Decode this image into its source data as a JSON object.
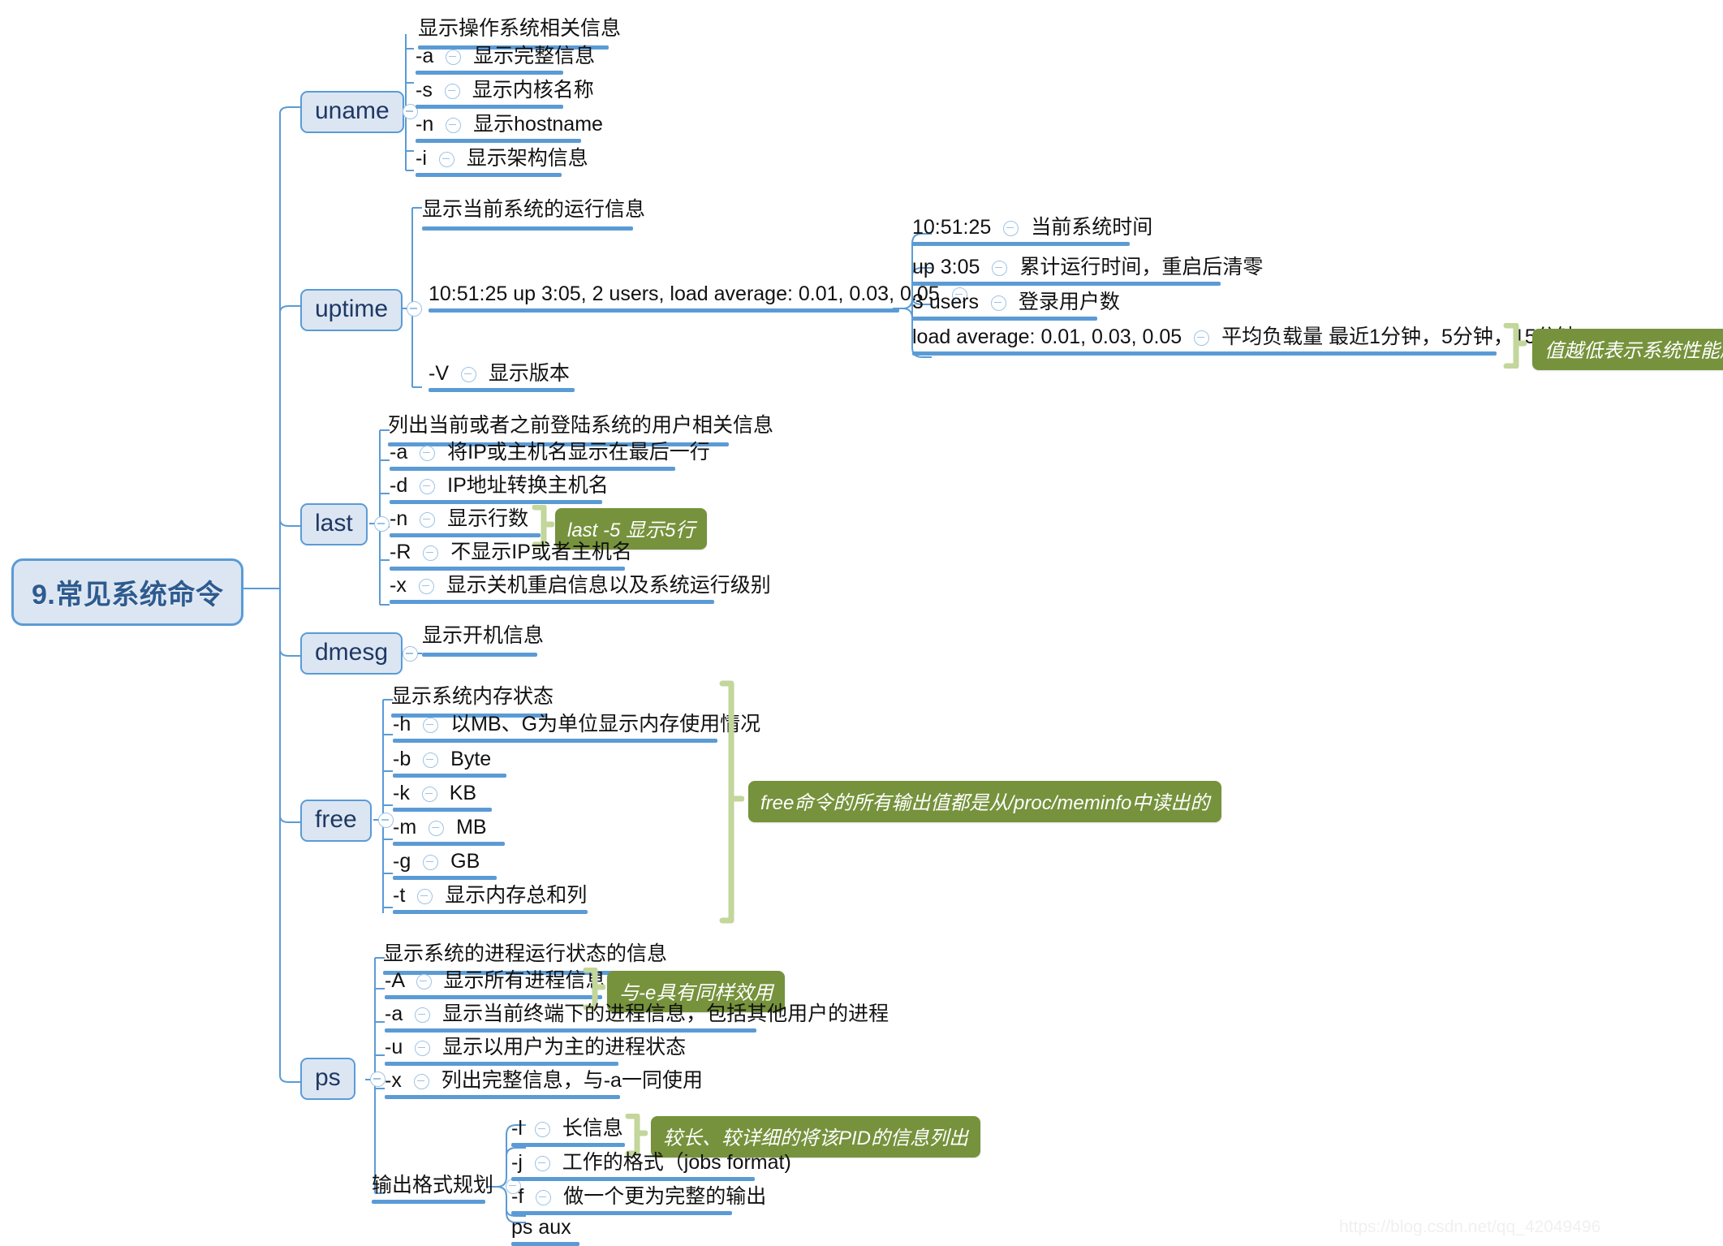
{
  "root": {
    "label": "9.常见系统命令"
  },
  "watermark": {
    "text": "https://blog.csdn.net/qq_42049496"
  },
  "colors": {
    "node_fill": "#dce6f2",
    "node_border": "#5b9bd5",
    "underline": "#5b9bd5",
    "callout_bg": "#76923c",
    "callout_text": "#ffffff",
    "brace": "#c3d69b",
    "root_text": "#2e5b8f"
  },
  "branches": [
    {
      "name": "uname",
      "label": "uname",
      "topic": "显示操作系统相关信息",
      "children": [
        {
          "flag": "-a",
          "desc": "显示完整信息"
        },
        {
          "flag": "-s",
          "desc": "显示内核名称"
        },
        {
          "flag": "-n",
          "desc": "显示hostname"
        },
        {
          "flag": "-i",
          "desc": "显示架构信息"
        }
      ]
    },
    {
      "name": "uptime",
      "label": "uptime",
      "topic": "显示当前系统的运行信息",
      "children": [
        {
          "flag": "10:51:25 up  3:05,  2 users,  load average: 0.01, 0.03, 0.05",
          "desc": ""
        },
        {
          "flag": "-V",
          "desc": "显示版本"
        }
      ],
      "grandchildren": [
        {
          "flag": "10:51:25",
          "desc": "当前系统时间"
        },
        {
          "flag": "up  3:05",
          "desc": "累计运行时间，重启后清零"
        },
        {
          "flag": "3 users",
          "desc": "登录用户数"
        },
        {
          "flag": "load average: 0.01, 0.03, 0.05",
          "desc": "平均负载量 最近1分钟，5分钟，15分钟"
        }
      ]
    },
    {
      "name": "last",
      "label": "last",
      "topic": "列出当前或者之前登陆系统的用户相关信息",
      "children": [
        {
          "flag": "-a",
          "desc": "将IP或主机名显示在最后一行"
        },
        {
          "flag": "-d",
          "desc": "IP地址转换主机名"
        },
        {
          "flag": "-n",
          "desc": "显示行数"
        },
        {
          "flag": "-R",
          "desc": "不显示IP或者主机名"
        },
        {
          "flag": "-x",
          "desc": "显示关机重启信息以及系统运行级别"
        }
      ]
    },
    {
      "name": "dmesg",
      "label": "dmesg",
      "topic": "显示开机信息",
      "children": []
    },
    {
      "name": "free",
      "label": "free",
      "topic": "显示系统内存状态",
      "children": [
        {
          "flag": "-h",
          "desc": "以MB、G为单位显示内存使用情况"
        },
        {
          "flag": "-b",
          "desc": "Byte"
        },
        {
          "flag": "-k",
          "desc": "KB"
        },
        {
          "flag": "-m",
          "desc": "MB"
        },
        {
          "flag": "-g",
          "desc": "GB"
        },
        {
          "flag": "-t",
          "desc": "显示内存总和列"
        }
      ]
    },
    {
      "name": "ps",
      "label": "ps",
      "topic": "显示系统的进程运行状态的信息",
      "children": [
        {
          "flag": "-A",
          "desc": "显示所有进程信息"
        },
        {
          "flag": "-a",
          "desc": "显示当前终端下的进程信息，包括其他用户的进程"
        },
        {
          "flag": "-u",
          "desc": "显示以用户为主的进程状态"
        },
        {
          "flag": "-x",
          "desc": "列出完整信息，与-a一同使用"
        }
      ],
      "subgroup": {
        "label": "输出格式规划",
        "children": [
          {
            "flag": "-l",
            "desc": "长信息"
          },
          {
            "flag": "-j",
            "desc": "工作的格式（jobs format)"
          },
          {
            "flag": "-f",
            "desc": "做一个更为完整的输出"
          },
          {
            "flag": "ps aux",
            "desc": ""
          }
        ]
      }
    }
  ],
  "callouts": [
    {
      "id": "load-avg-note",
      "text": "值越低表示系统性能越好"
    },
    {
      "id": "last-n-note",
      "text": "last -5 显示5行"
    },
    {
      "id": "free-note",
      "text": "free命令的所有输出值都是从/proc/meminfo中读出的"
    },
    {
      "id": "ps-A-note",
      "text": "与-e具有同样效用"
    },
    {
      "id": "ps-l-note",
      "text": "较长、较详细的将该PID的信息列出"
    }
  ]
}
